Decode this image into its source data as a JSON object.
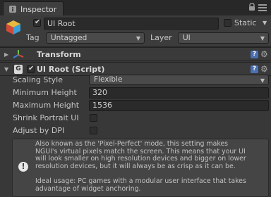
{
  "window": {
    "tab_label": "Inspector"
  },
  "game_object": {
    "name": "UI Root",
    "active": true,
    "static_label": "Static",
    "static_checked": false,
    "tag_label": "Tag",
    "tag_value": "Untagged",
    "layer_label": "Layer",
    "layer_value": "UI"
  },
  "components": {
    "transform": {
      "title": "Transform",
      "help_icon": "?",
      "gear_icon": "gear-icon"
    },
    "ui_root": {
      "title": "UI Root (Script)",
      "enabled": true,
      "help_icon": "?",
      "gear_icon": "gear-icon",
      "properties": {
        "scaling_style_label": "Scaling Style",
        "scaling_style_value": "Flexible",
        "min_height_label": "Minimum Height",
        "min_height_value": "320",
        "max_height_label": "Maximum Height",
        "max_height_value": "1536",
        "shrink_label": "Shrink Portrait UI",
        "shrink_checked": false,
        "adjust_dpi_label": "Adjust by DPI",
        "adjust_dpi_checked": false
      },
      "help": {
        "text": "Also known as the 'Pixel-Perfect' mode, this setting makes\nNGUI's virtual pixels match the screen. This means that your UI\nwill look smaller on high resolution devices and bigger on lower\nresolution devices, but it will always be as crisp as it can be.\n\nIdeal usage: PC games with a modular user interface that takes\nadvantage of widget anchoring.",
        "icon": "!"
      }
    }
  },
  "colors": {
    "background": "#383838",
    "help_blue": "#4b6fb3"
  }
}
